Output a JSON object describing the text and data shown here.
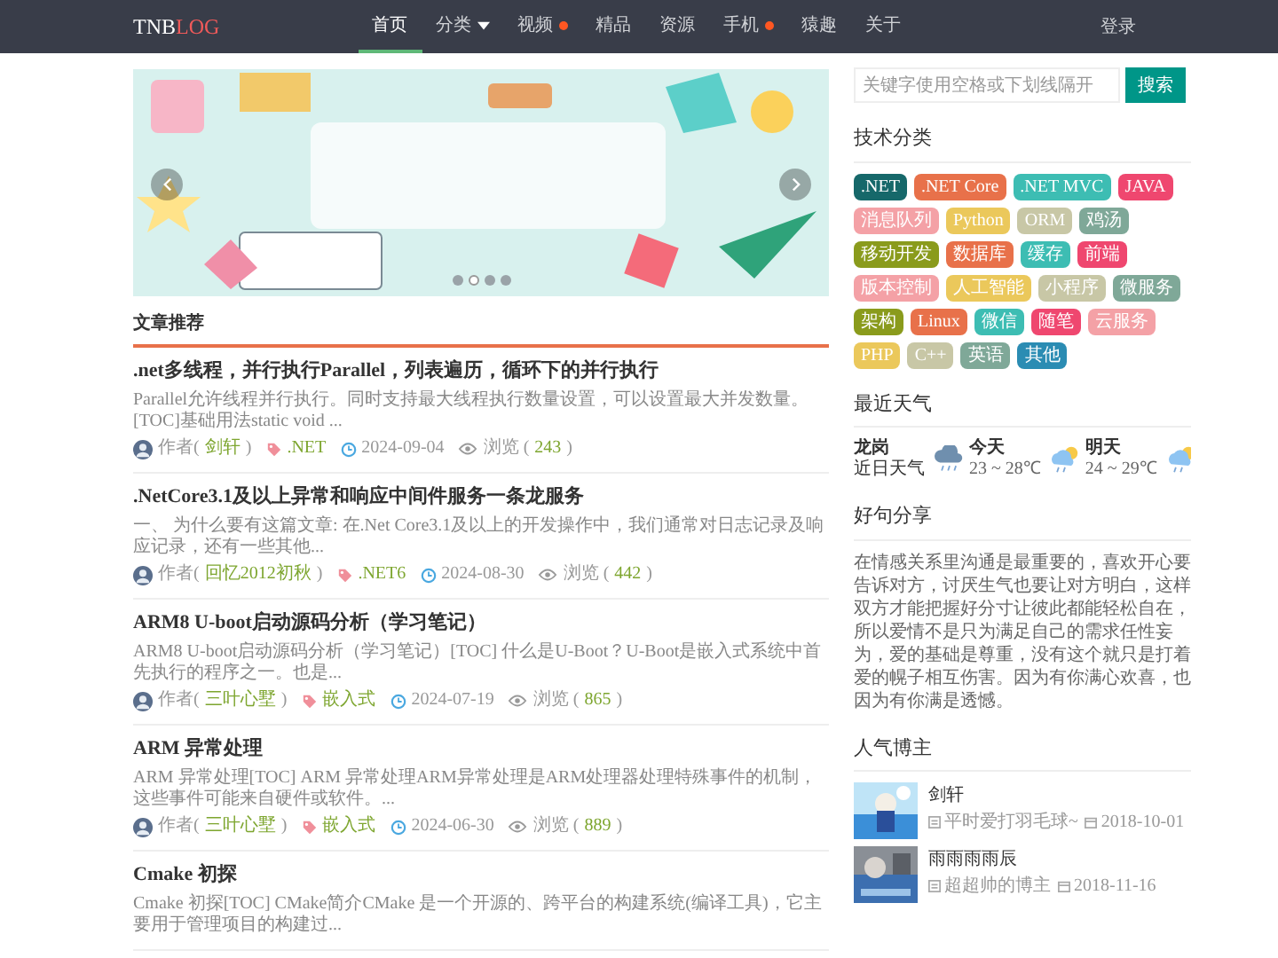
{
  "nav": {
    "logo": {
      "first": "TNB",
      "second": "LOG"
    },
    "items": [
      {
        "label": "首页",
        "selected": true,
        "caret": false,
        "dot": false
      },
      {
        "label": "分类",
        "selected": false,
        "caret": true,
        "dot": false
      },
      {
        "label": "视频",
        "selected": false,
        "caret": false,
        "dot": true
      },
      {
        "label": "精品",
        "selected": false,
        "caret": false,
        "dot": false
      },
      {
        "label": "资源",
        "selected": false,
        "caret": false,
        "dot": false
      },
      {
        "label": "手机",
        "selected": false,
        "caret": false,
        "dot": true
      },
      {
        "label": "猿趣",
        "selected": false,
        "caret": false,
        "dot": false
      },
      {
        "label": "关于",
        "selected": false,
        "caret": false,
        "dot": false
      }
    ],
    "login": "登录"
  },
  "banner": {
    "kind": "picture",
    "slides": [
      {
        "selected": false
      },
      {
        "selected": true
      },
      {
        "selected": false
      },
      {
        "selected": false
      }
    ]
  },
  "articles": {
    "heading": "文章推荐",
    "items": [
      {
        "title": ".net多线程，并行执行Parallel，列表遍历，循环下的并行执行",
        "summary": "Parallel允许线程并行执行。同时支持最大线程执行数量设置，可以设置最大并发数量。 [TOC]基础用法static void ...",
        "author_label": "作者(",
        "author": "剑轩",
        "author_end": ")",
        "tag": ".NET",
        "date": "2024-09-04",
        "views_label": "浏览 (",
        "views": "243",
        "views_end": ")"
      },
      {
        "title": ".NetCore3.1及以上异常和响应中间件服务一条龙服务",
        "summary": "一、 为什么要有这篇文章: 在.Net Core3.1及以上的开发操作中，我们通常对日志记录及响应记录，还有一些其他...",
        "author_label": "作者(",
        "author": "回忆2012初秋",
        "author_end": ")",
        "tag": ".NET6",
        "date": "2024-08-30",
        "views_label": "浏览 (",
        "views": "442",
        "views_end": ")"
      },
      {
        "title": "ARM8 U-boot启动源码分析（学习笔记）",
        "summary": "ARM8 U-boot启动源码分析（学习笔记）[TOC] 什么是U-Boot？U-Boot是嵌入式系统中首先执行的程序之一。也是...",
        "author_label": "作者(",
        "author": "三叶心墅",
        "author_end": ")",
        "tag": "嵌入式",
        "date": "2024-07-19",
        "views_label": "浏览 (",
        "views": "865",
        "views_end": ")"
      },
      {
        "title": "ARM 异常处理",
        "summary": "ARM 异常处理[TOC] ARM 异常处理ARM异常处理是ARM处理器处理特殊事件的机制，这些事件可能来自硬件或软件。...",
        "author_label": "作者(",
        "author": "三叶心墅",
        "author_end": ")",
        "tag": "嵌入式",
        "date": "2024-06-30",
        "views_label": "浏览 (",
        "views": "889",
        "views_end": ")"
      },
      {
        "title": "Cmake 初探",
        "summary": "Cmake 初探[TOC] CMake简介CMake 是一个开源的、跨平台的构建系统(编译工具)，它主要用于管理项目的构建过..."
      }
    ]
  },
  "search": {
    "placeholder": "关键字使用空格或下划线隔开",
    "button": "搜索"
  },
  "categories": {
    "title": "技术分类",
    "tags": [
      {
        "label": ".NET",
        "color": "#16686a"
      },
      {
        "label": ".NET Core",
        "color": "#e8714a"
      },
      {
        "label": ".NET MVC",
        "color": "#3dbdb3"
      },
      {
        "label": "JAVA",
        "color": "#ef476f"
      },
      {
        "label": "消息队列",
        "color": "#f4a1a6"
      },
      {
        "label": "Python",
        "color": "#ebc85b"
      },
      {
        "label": "ORM",
        "color": "#c8c7a6"
      },
      {
        "label": "鸡汤",
        "color": "#7fa898"
      },
      {
        "label": "移动开发",
        "color": "#8a9b1c"
      },
      {
        "label": "数据库",
        "color": "#e8714a"
      },
      {
        "label": "缓存",
        "color": "#3dbdb3"
      },
      {
        "label": "前端",
        "color": "#ef476f"
      },
      {
        "label": "版本控制",
        "color": "#f4a1a6"
      },
      {
        "label": "人工智能",
        "color": "#ebc85b"
      },
      {
        "label": "小程序",
        "color": "#c8c7a6"
      },
      {
        "label": "微服务",
        "color": "#7fa898"
      },
      {
        "label": "架构",
        "color": "#8a9b1c"
      },
      {
        "label": "Linux",
        "color": "#e8714a"
      },
      {
        "label": "微信",
        "color": "#3dbdb3"
      },
      {
        "label": "随笔",
        "color": "#ef476f"
      },
      {
        "label": "云服务",
        "color": "#f4a1a6"
      },
      {
        "label": "PHP",
        "color": "#ebc85b"
      },
      {
        "label": "C++",
        "color": "#c8c7a6"
      },
      {
        "label": "英语",
        "color": "#7fa898"
      },
      {
        "label": "其他",
        "color": "#2b8cb3"
      }
    ]
  },
  "weather": {
    "title": "最近天气",
    "city": "龙岗",
    "caption": "近日天气",
    "days": [
      {
        "kind": "rain",
        "day": "今天",
        "temp": "23 ~ 28℃"
      },
      {
        "kind": "sun-rain",
        "day": "明天",
        "temp": "24 ~ 29℃"
      },
      {
        "kind": "sun-rain"
      }
    ]
  },
  "quote": {
    "title": "好句分享",
    "text": "在情感关系里沟通是最重要的，喜欢开心要告诉对方，讨厌生气也要让对方明白，这样双方才能把握好分寸让彼此都能轻松自在，所以爱情不是只为满足自己的需求任性妄为，爱的基础是尊重，没有这个就只是打着爱的幌子相互伤害。因为有你满心欢喜，也因为有你满是透憾。"
  },
  "bloggers": {
    "title": "人气博主",
    "items": [
      {
        "name": "剑轩",
        "motto": "平时爱打羽毛球~",
        "date": "2018-10-01"
      },
      {
        "name": "雨雨雨雨辰",
        "motto": "超超帅的博主",
        "date": "2018-11-16"
      }
    ]
  }
}
